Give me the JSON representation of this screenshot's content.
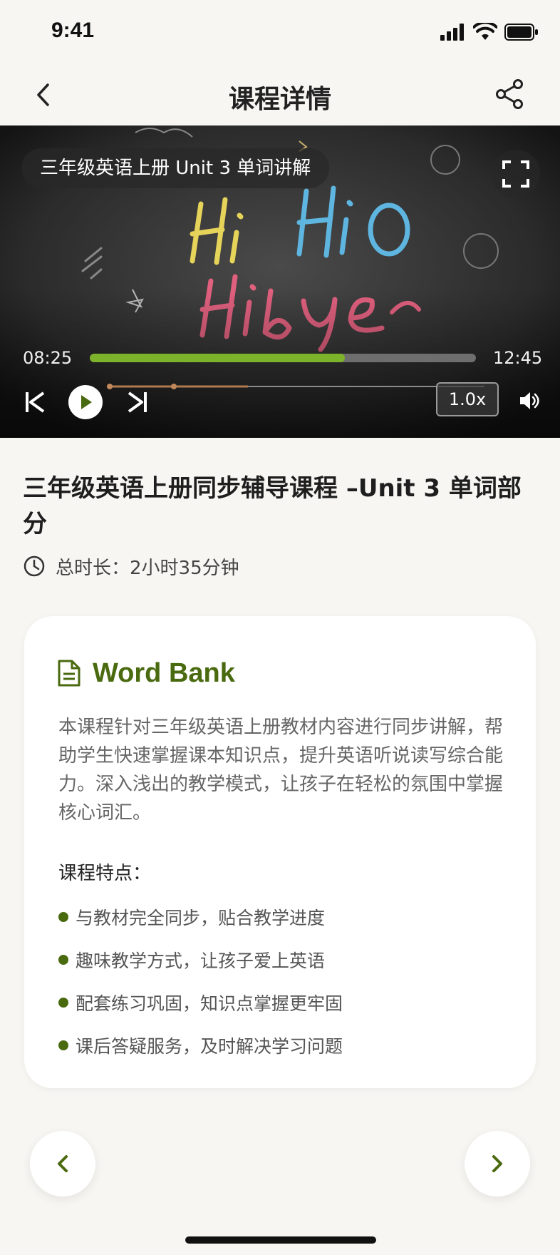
{
  "status_bar": {
    "time": "9:41",
    "icons": [
      "signal-icon",
      "wifi-icon",
      "battery-icon"
    ]
  },
  "nav": {
    "title": "课程详情",
    "back_icon": "chevron-left-icon",
    "share_icon": "share-icon"
  },
  "video": {
    "overlay_title": "三年级英语上册 Unit 3 单词讲解",
    "current_time": "08:25",
    "total_time": "12:45",
    "progress": 0.66,
    "speed": "1.0x",
    "colors": {
      "progress": "#7cb32a",
      "track": "#6e6e6e"
    }
  },
  "course": {
    "title": "三年级英语上册同步辅导课程 –Unit 3 单词部分",
    "duration": "总时长：2小时35分钟"
  },
  "card": {
    "title": "Word Bank",
    "description": "本课程针对三年级英语上册教材内容进行同步讲解，帮助学生快速掌握课本知识点，提升英语听说读写综合能力。深入浅出的教学模式，让孩子在轻松的氛围中掌握核心词汇。",
    "features_label": "课程特点：",
    "features": [
      "与教材完全同步，贴合教学进度",
      "趣味教学方式，让孩子爱上英语",
      "配套练习巩固，知识点掌握更牢固",
      "课后答疑服务，及时解决学习问题"
    ]
  },
  "accent_color": "#4a6a0f"
}
